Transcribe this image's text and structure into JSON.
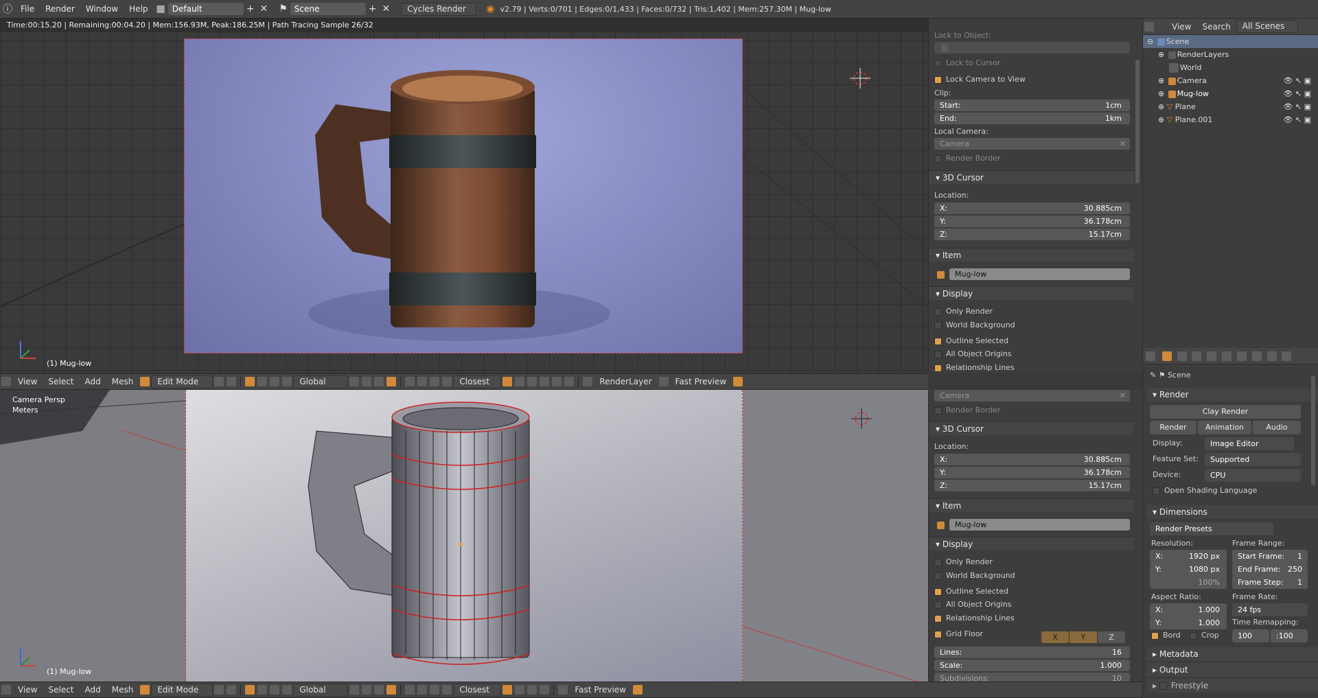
{
  "topbar": {
    "menus": [
      "File",
      "Render",
      "Window",
      "Help"
    ],
    "screen_layout": "Default",
    "scene": "Scene",
    "engine": "Cycles Render",
    "stats": "v2.79 | Verts:0/701 | Edges:0/1,433 | Faces:0/732 | Tris:1,402 | Mem:257.30M | Mug-low"
  },
  "top_view": {
    "render_info": "Time:00:15.20 | Remaining:00:04.20 | Mem:156.93M, Peak:186.25M | Path Tracing Sample 26/32",
    "object_label": "(1) Mug-low"
  },
  "bottom_view": {
    "view_name": "Camera Persp",
    "units": "Meters",
    "object_label": "(1) Mug-low"
  },
  "view_header": {
    "menus": [
      "View",
      "Select",
      "Add",
      "Mesh"
    ],
    "mode": "Edit Mode",
    "orientation": "Global",
    "snap": "Closest",
    "render_layer": "RenderLayer",
    "preview": "Fast Preview"
  },
  "npanel_top": {
    "lock_to_object": "Lock to Object:",
    "lock_to_cursor": "Lock to Cursor",
    "lock_camera_to_view": "Lock Camera to View",
    "clip": "Clip:",
    "clip_start_label": "Start:",
    "clip_start": "1cm",
    "clip_end_label": "End:",
    "clip_end": "1km",
    "local_camera": "Local Camera:",
    "camera": "Camera",
    "render_border": "Render Border",
    "cursor_head": "3D Cursor",
    "location": "Location:",
    "x_label": "X:",
    "x": "30.885cm",
    "y_label": "Y:",
    "y": "36.178cm",
    "z_label": "Z:",
    "z": "15.17cm",
    "item_head": "Item",
    "item_name": "Mug-low",
    "display_head": "Display",
    "only_render": "Only Render",
    "world_background": "World Background",
    "outline_selected": "Outline Selected",
    "all_object_origins": "All Object Origins",
    "relationship_lines": "Relationship Lines"
  },
  "npanel_bottom": {
    "camera": "Camera",
    "render_border": "Render Border",
    "cursor_head": "3D Cursor",
    "location": "Location:",
    "x_label": "X:",
    "x": "30.885cm",
    "y_label": "Y:",
    "y": "36.178cm",
    "z_label": "Z:",
    "z": "15.17cm",
    "item_head": "Item",
    "item_name": "Mug-low",
    "display_head": "Display",
    "only_render": "Only Render",
    "world_background": "World Background",
    "outline_selected": "Outline Selected",
    "all_object_origins": "All Object Origins",
    "relationship_lines": "Relationship Lines",
    "grid_floor": "Grid Floor",
    "axis_x": "X",
    "axis_y": "Y",
    "axis_z": "Z",
    "lines_label": "Lines:",
    "lines": "16",
    "scale_label": "Scale:",
    "scale": "1.000",
    "subdivisions_label": "Subdivisions:",
    "subdivisions": "10"
  },
  "outliner": {
    "header_menus": [
      "View",
      "Search"
    ],
    "filter": "All Scenes",
    "items": [
      "Scene",
      "RenderLayers",
      "World",
      "Camera",
      "Mug-low",
      "Plane",
      "Plane.001"
    ]
  },
  "properties": {
    "scene": "Scene",
    "render_head": "Render",
    "clay_render": "Clay Render",
    "render_btn": "Render",
    "animation_btn": "Animation",
    "audio_btn": "Audio",
    "display_label": "Display:",
    "display": "Image Editor",
    "feature_set_label": "Feature Set:",
    "feature_set": "Supported",
    "device_label": "Device:",
    "device": "CPU",
    "osl": "Open Shading Language",
    "dimensions_head": "Dimensions",
    "render_presets": "Render Presets",
    "resolution": "Resolution:",
    "res_x_label": "X:",
    "res_x": "1920 px",
    "res_y_label": "Y:",
    "res_y": "1080 px",
    "res_pct": "100%",
    "frame_range": "Frame Range:",
    "start_frame": "Start Frame:",
    "start_frame_val": "1",
    "end_frame": "End Frame:",
    "end_frame_val": "250",
    "frame_step": "Frame Step:",
    "frame_step_val": "1",
    "aspect_ratio": "Aspect Ratio:",
    "asp_x_label": "X:",
    "asp_x": "1.000",
    "asp_y_label": "Y:",
    "asp_y": "1.000",
    "frame_rate": "Frame Rate:",
    "fps": "24 fps",
    "time_remapping": "Time Remapping:",
    "bord": "Bord",
    "crop": "Crop",
    "remap_old": "100",
    "remap_new": ":100",
    "metadata_head": "Metadata",
    "output_head": "Output",
    "freestyle_head": "Freestyle"
  }
}
